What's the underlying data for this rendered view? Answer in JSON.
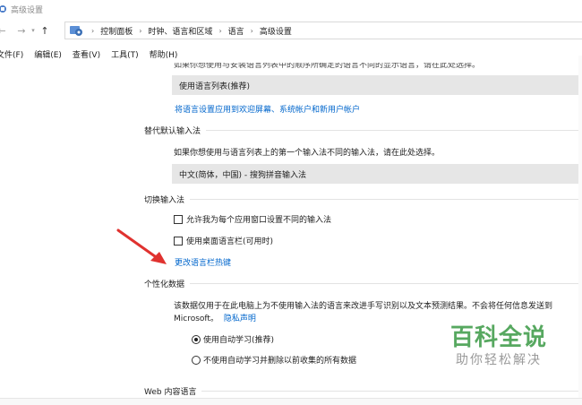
{
  "window": {
    "title": "高级设置"
  },
  "address_bar": {
    "breadcrumbs": [
      "控制面板",
      "时钟、语言和区域",
      "语言",
      "高级设置"
    ]
  },
  "menu": {
    "items": [
      "文件(F)",
      "编辑(E)",
      "查看(V)",
      "工具(T)",
      "帮助(H)"
    ]
  },
  "display_language": {
    "partial_desc": "如果你想使用与安装语言列表中的顺序所确定的语言不同的显示语言，请在此处选择。",
    "dropdown_value": "使用语言列表(推荐)",
    "apply_link": "将语言设置应用到欢迎屏幕、系统帐户和新用户帐户"
  },
  "input_method": {
    "heading": "替代默认输入法",
    "desc": "如果你想使用与语言列表上的第一个输入法不同的输入法，请在此处选择。",
    "dropdown_value": "中文(简体，中国) - 搜狗拼音输入法"
  },
  "switch_input": {
    "heading": "切换输入法",
    "checkbox1": "允许我为每个应用窗口设置不同的输入法",
    "checkbox2": "使用桌面语言栏(可用时)",
    "hotkey_link": "更改语言栏热键"
  },
  "personalization": {
    "heading": "个性化数据",
    "desc_line1": "该数据仅用于在此电脑上为不使用输入法的语言来改进手写识别以及文本预测结果。不会将任何信息发送到",
    "desc_line2": "Microsoft。",
    "privacy_link": "隐私声明",
    "radio1": "使用自动学习(推荐)",
    "radio2": "不使用自动学习并删除以前收集的所有数据",
    "radio_selected": 1
  },
  "web_content": {
    "heading": "Web 内容语言"
  },
  "watermark": {
    "main": "百科全说",
    "sub": "助你轻松解决"
  },
  "colors": {
    "link": "#0066cc",
    "annotation_arrow": "#e0322f",
    "watermark_green": "#3a9a45"
  }
}
